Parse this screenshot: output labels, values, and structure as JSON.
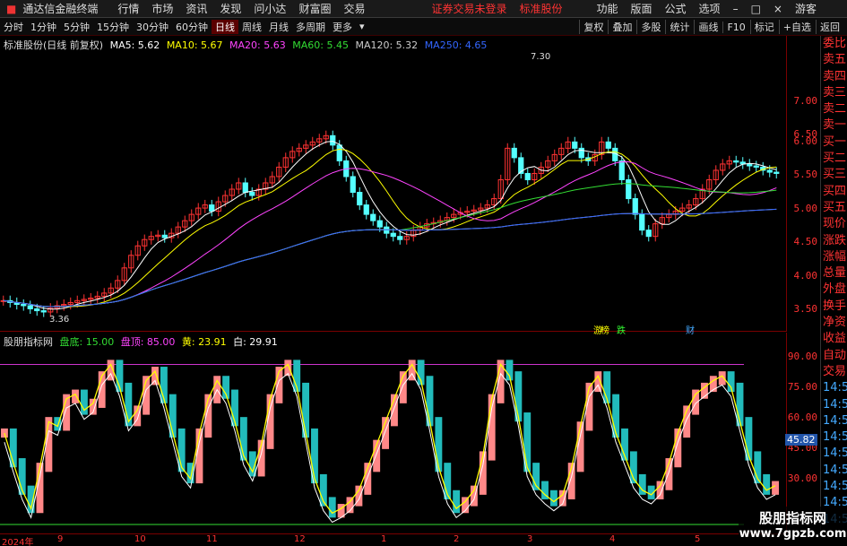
{
  "titlebar": {
    "app_name": "通达信金融终端",
    "menus": [
      "行情",
      "市场",
      "资讯",
      "发现",
      "问小达",
      "财富圈",
      "交易"
    ],
    "notice": "证券交易未登录",
    "stock": "标准股份",
    "right_menus": [
      "功能",
      "版面",
      "公式",
      "选项"
    ],
    "user": "游客"
  },
  "timebar": {
    "periods": [
      "分时",
      "1分钟",
      "5分钟",
      "15分钟",
      "30分钟",
      "60分钟",
      "日线",
      "周线",
      "月线",
      "多周期",
      "更多"
    ],
    "active": "日线",
    "tools": [
      "复权",
      "叠加",
      "多股",
      "统计",
      "画线",
      "F10",
      "标记",
      "+自选",
      "返回"
    ]
  },
  "main": {
    "legend_title": "标准股份(日线 前复权)",
    "ma": [
      {
        "label": "MA5: 5.62",
        "color": "#ffffff"
      },
      {
        "label": "MA10: 5.67",
        "color": "#ffff00"
      },
      {
        "label": "MA20: 5.63",
        "color": "#ff44ff"
      },
      {
        "label": "MA60: 5.45",
        "color": "#33dd33"
      },
      {
        "label": "MA120: 5.32",
        "color": "#cccccc"
      },
      {
        "label": "MA250: 4.65",
        "color": "#3366ff"
      }
    ],
    "high_label": "7.30",
    "low_label": "3.36",
    "yticks": [
      "7.00",
      "6.50",
      "6.00",
      "5.50",
      "5.00",
      "4.50",
      "4.00",
      "3.50"
    ],
    "events": [
      {
        "text": "游",
        "color": "#ff3"
      },
      {
        "text": "榜",
        "color": "#ff3"
      },
      {
        "text": "跌",
        "color": "#3f3"
      },
      {
        "text": "财",
        "color": "#4af"
      }
    ]
  },
  "indicator": {
    "name": "股朋指标网",
    "bottom_label": "盘底: 15.00",
    "top_label": "盘顶: 85.00",
    "yellow_label": "黄: 23.91",
    "white_label": "白: 29.91",
    "yticks": [
      "90.00",
      "75.00",
      "60.00",
      "45.00",
      "30.00"
    ],
    "current": "45.82"
  },
  "sidepanel": {
    "items": [
      "委比",
      "卖五",
      "卖四",
      "卖三",
      "卖二",
      "卖一",
      "买一",
      "买二",
      "买三",
      "买四",
      "买五",
      "现价",
      "涨跌",
      "涨幅",
      "总量",
      "外盘",
      "换手",
      "净资",
      "收益",
      "自动",
      "交易",
      "14:56",
      "14:56",
      "14:56",
      "14:56",
      "14:56",
      "14:56",
      "14:56",
      "14:56",
      "14:56"
    ]
  },
  "dates": [
    "2024年",
    "9",
    "10",
    "11",
    "12",
    "1",
    "2",
    "3",
    "4",
    "5"
  ],
  "watermark": {
    "line1": "股朋指标网",
    "line2": "www.7gpzb.com"
  },
  "chart_data": {
    "type": "candlestick",
    "ylim": [
      3.3,
      7.5
    ],
    "indicator_ylim": [
      15,
      95
    ],
    "closes": [
      3.58,
      3.55,
      3.52,
      3.5,
      3.45,
      3.42,
      3.4,
      3.46,
      3.5,
      3.52,
      3.55,
      3.58,
      3.6,
      3.62,
      3.65,
      3.7,
      3.78,
      3.9,
      4.1,
      4.3,
      4.45,
      4.55,
      4.6,
      4.62,
      4.58,
      4.65,
      4.75,
      4.85,
      4.95,
      5.05,
      5.1,
      5.0,
      5.15,
      5.25,
      5.35,
      5.45,
      5.3,
      5.25,
      5.35,
      5.45,
      5.55,
      5.7,
      5.85,
      5.95,
      6.0,
      6.05,
      6.1,
      6.15,
      6.2,
      6.05,
      5.8,
      5.55,
      5.3,
      5.1,
      4.95,
      4.85,
      4.75,
      4.65,
      4.6,
      4.55,
      4.6,
      4.7,
      4.75,
      4.8,
      4.82,
      4.85,
      4.9,
      4.95,
      4.98,
      5.0,
      5.02,
      5.05,
      5.1,
      5.2,
      5.5,
      6.0,
      5.85,
      5.6,
      5.5,
      5.6,
      5.7,
      5.8,
      5.9,
      6.0,
      6.1,
      6.0,
      5.85,
      5.8,
      5.9,
      6.1,
      6.0,
      5.8,
      5.5,
      5.2,
      4.95,
      4.7,
      4.6,
      4.8,
      4.9,
      4.95,
      5.0,
      5.05,
      5.1,
      5.2,
      5.35,
      5.5,
      5.65,
      5.75,
      5.8,
      5.78,
      5.75,
      5.72,
      5.7,
      5.65,
      5.62,
      5.6
    ],
    "indicator_yellow": [
      55,
      42,
      30,
      22,
      40,
      60,
      58,
      70,
      72,
      65,
      68,
      80,
      85,
      75,
      60,
      65,
      78,
      82,
      70,
      55,
      40,
      35,
      55,
      70,
      78,
      72,
      60,
      45,
      38,
      50,
      70,
      82,
      85,
      75,
      55,
      35,
      25,
      20,
      22,
      25,
      30,
      40,
      50,
      60,
      70,
      80,
      85,
      78,
      60,
      40,
      28,
      22,
      25,
      30,
      45,
      70,
      85,
      80,
      62,
      40,
      32,
      28,
      25,
      28,
      40,
      58,
      75,
      80,
      70,
      55,
      45,
      35,
      30,
      28,
      32,
      42,
      55,
      65,
      72,
      75,
      78,
      80,
      75,
      60,
      45,
      35,
      30,
      32
    ]
  }
}
